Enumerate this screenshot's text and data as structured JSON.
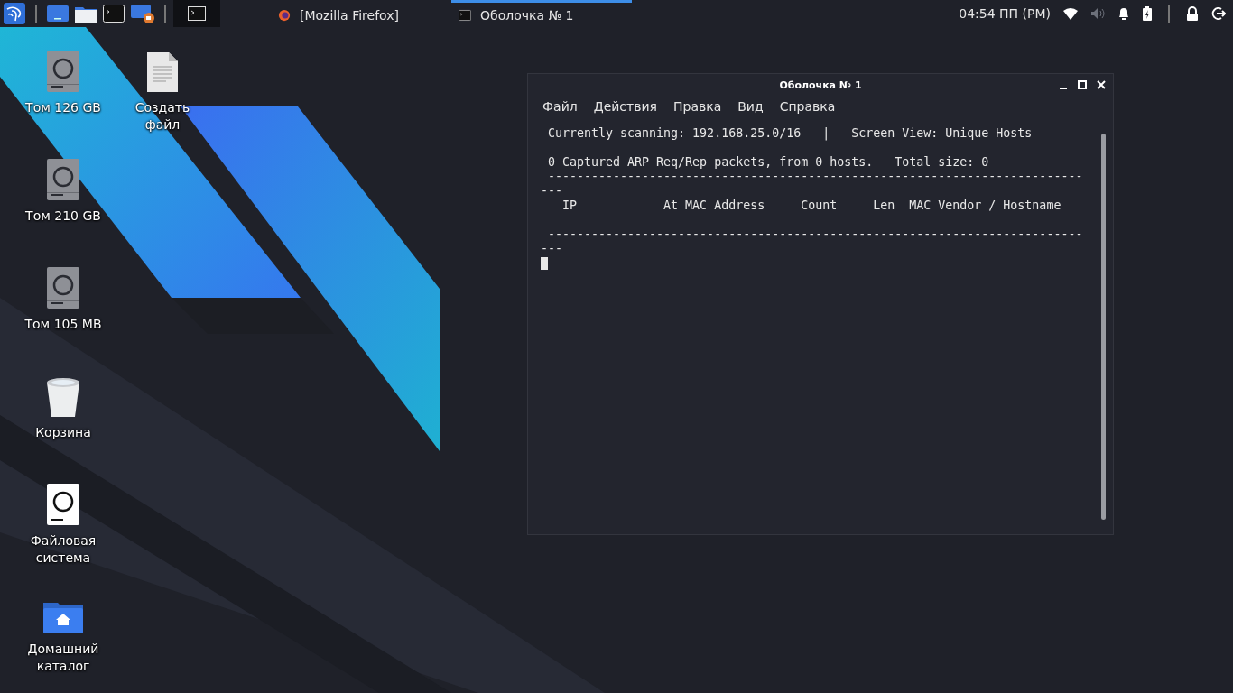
{
  "taskbar": {
    "launchers": [
      {
        "kind": "menu"
      },
      {
        "kind": "desktop"
      },
      {
        "kind": "files"
      },
      {
        "kind": "terminal"
      },
      {
        "kind": "recorder"
      }
    ],
    "workspace": {
      "selected": true
    },
    "tasks": [
      {
        "kind": "browser",
        "label": "[Mozilla Firefox]",
        "selected": false
      },
      {
        "kind": "terminal",
        "label": "Оболочка № 1",
        "selected": true
      }
    ],
    "clock": "04:54 ПП (PM)",
    "tray": [
      {
        "kind": "wifi"
      },
      {
        "kind": "volume"
      },
      {
        "kind": "bell"
      },
      {
        "kind": "battery"
      },
      {
        "kind": "separator"
      },
      {
        "kind": "lock"
      },
      {
        "kind": "logout"
      }
    ]
  },
  "desktop_icons": [
    {
      "kind": "volume",
      "label": "Том 126 GB"
    },
    {
      "kind": "volume",
      "label": "Том 210 GB"
    },
    {
      "kind": "volume",
      "label": "Том 105 MB"
    },
    {
      "kind": "trash",
      "label": "Корзина"
    },
    {
      "kind": "filesystem",
      "label": "Файловая система"
    },
    {
      "kind": "home",
      "label": "Домашний каталог"
    },
    {
      "kind": "document",
      "label": "Создать файл"
    }
  ],
  "terminal_window": {
    "title": "Оболочка № 1",
    "menu": [
      "Файл",
      "Действия",
      "Правка",
      "Вид",
      "Справка"
    ],
    "status_line": " Currently scanning: 192.168.25.0/16   |   Screen View: Unique Hosts",
    "summary_line": " 0 Captured ARP Req/Rep packets, from 0 hosts.   Total size: 0",
    "rule_top": " --------------------------------------------------------------------------",
    "rule_top_wrap": "---",
    "header": "   IP            At MAC Address     Count     Len  MAC Vendor / Hostname",
    "rule_bottom": " --------------------------------------------------------------------------",
    "rule_bottom_wrap": "---"
  }
}
